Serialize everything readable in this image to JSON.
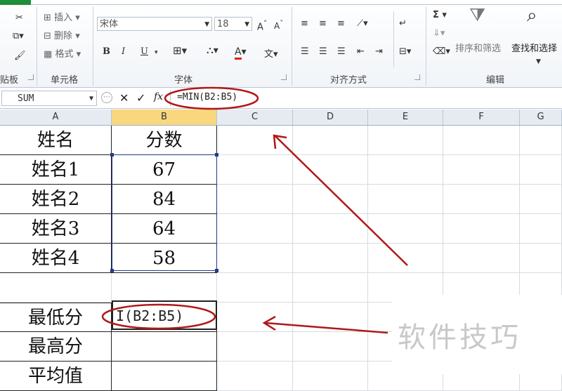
{
  "ribbon": {
    "clipboard": {
      "label": "贴板"
    },
    "cells": {
      "label": "单元格",
      "insert": "插入",
      "delete": "删除",
      "format": "格式"
    },
    "font": {
      "label": "字体",
      "name": "宋体",
      "size": "18",
      "bold": "B",
      "italic": "I",
      "underline": "U",
      "font_color": "A"
    },
    "alignment": {
      "label": "对齐方式"
    },
    "editing": {
      "label": "编辑",
      "sort_filter": "排序和筛选",
      "find_select": "查找和选择",
      "sum": "Σ"
    }
  },
  "formula_bar": {
    "name_box": "SUM",
    "fx": "fx",
    "cancel": "✕",
    "enter": "✓",
    "formula": "=MIN(B2:B5)"
  },
  "columns": [
    "A",
    "B",
    "C",
    "D",
    "E",
    "F",
    "G"
  ],
  "rows": [
    {
      "a": "姓名",
      "b": "分数"
    },
    {
      "a": "姓名1",
      "b": "67"
    },
    {
      "a": "姓名2",
      "b": "84"
    },
    {
      "a": "姓名3",
      "b": "64"
    },
    {
      "a": "姓名4",
      "b": "58"
    },
    {
      "a": "",
      "b": ""
    },
    {
      "a": "最低分",
      "b": ""
    },
    {
      "a": "最高分",
      "b": ""
    },
    {
      "a": "平均值",
      "b": ""
    }
  ],
  "editing_cell": {
    "text": "I(B2:B5)"
  },
  "watermark": "软件技巧",
  "annotation_color": "#b01818"
}
